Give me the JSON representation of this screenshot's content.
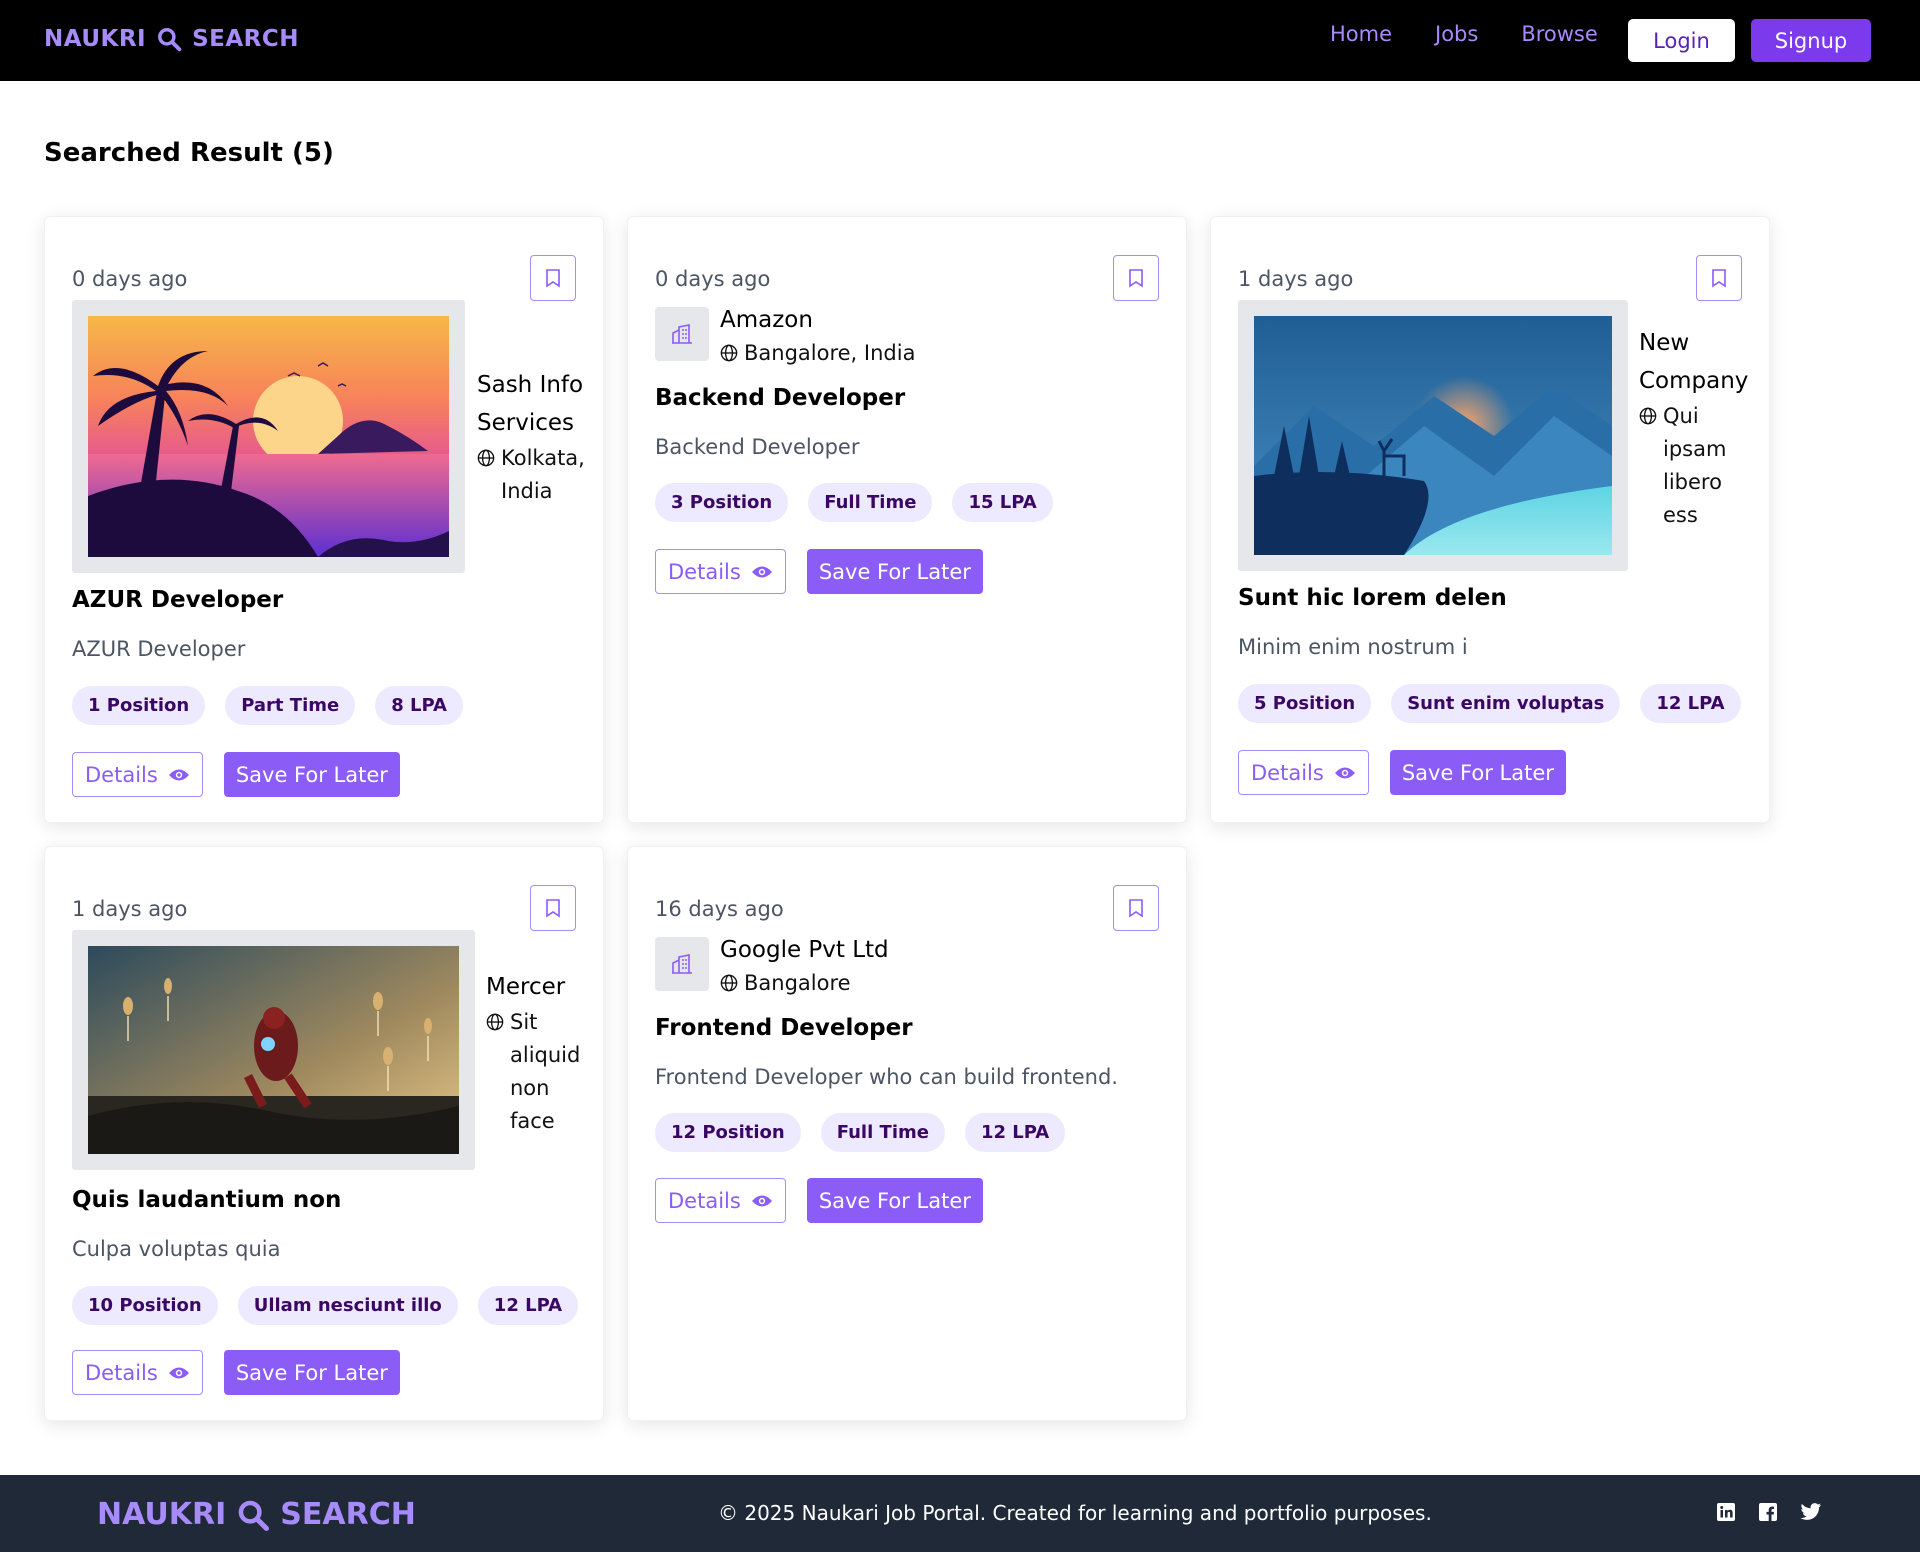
{
  "nav": {
    "brand": "NAUKRI",
    "brand_suffix": "SEARCH",
    "links": [
      "Home",
      "Jobs",
      "Browse"
    ],
    "login_label": "Login",
    "signup_label": "Signup"
  },
  "results": {
    "heading": "Searched Result (5)"
  },
  "jobs": [
    {
      "posted": "0 days ago",
      "company": "Sash Info Services",
      "location": "Kolkata, India",
      "title": "AZUR Developer",
      "description": "AZUR Developer",
      "positions": "1 Position",
      "type": "Part Time",
      "salary": "8 LPA",
      "image": "sunset-palm-illustration"
    },
    {
      "posted": "0 days ago",
      "company": "Amazon",
      "location": "Bangalore, India",
      "title": "Backend Developer",
      "description": "Backend Developer",
      "positions": "3 Position",
      "type": "Full Time",
      "salary": "15 LPA",
      "image": "building-icon"
    },
    {
      "posted": "1 days ago",
      "company": "New Company",
      "location": "Qui ipsam libero ess",
      "title": "Sunt hic lorem delen",
      "description": "Minim enim nostrum i",
      "positions": "5 Position",
      "type": "Sunt enim voluptas",
      "salary": "12 LPA",
      "image": "mountain-deer-illustration"
    },
    {
      "posted": "1 days ago",
      "company": "Mercer",
      "location": "Sit aliquid non face",
      "title": "Quis laudantium non",
      "description": "Culpa voluptas quia",
      "positions": "10 Position",
      "type": "Ullam nesciunt illo",
      "salary": "12 LPA",
      "image": "armored-hero-photo"
    },
    {
      "posted": "16 days ago",
      "company": "Google Pvt Ltd",
      "location": "Bangalore",
      "title": "Frontend Developer",
      "description": "Frontend Developer who can build frontend.",
      "positions": "12 Position",
      "type": "Full Time",
      "salary": "12 LPA",
      "image": "building-icon"
    }
  ],
  "buttons": {
    "details": "Details",
    "save": "Save For Later"
  },
  "footer": {
    "brand": "NAUKRI",
    "brand_suffix": "SEARCH",
    "copyright": "© 2025 Naukari Job Portal. Created for learning and portfolio purposes.",
    "social": [
      "linkedin-icon",
      "facebook-icon",
      "twitter-icon"
    ]
  },
  "colors": {
    "accent": "#8b5cf6",
    "accent_dark": "#7c3aed",
    "badge_bg": "#ede9fe",
    "footer_bg": "#1f2937",
    "nav_bg": "#000000"
  }
}
